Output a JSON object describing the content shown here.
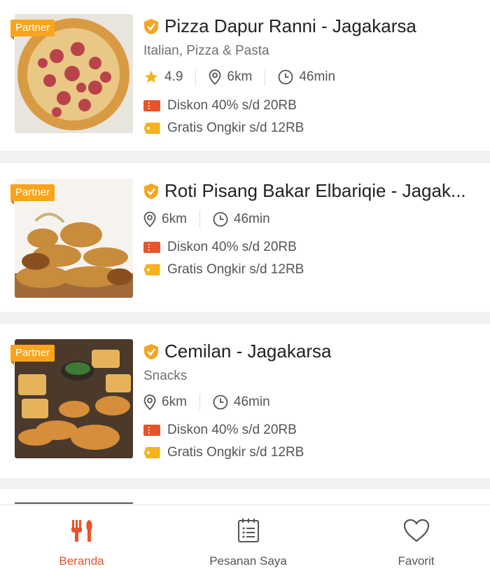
{
  "restaurants": [
    {
      "badge": "Partner",
      "name": "Pizza Dapur Ranni - Jagakarsa",
      "category": "Italian, Pizza & Pasta",
      "rating": "4.9",
      "distance": "6km",
      "time": "46min",
      "promo_discount": "Diskon 40% s/d 20RB",
      "promo_delivery": "Gratis Ongkir s/d 12RB"
    },
    {
      "badge": "Partner",
      "name": "Roti Pisang Bakar Elbariqie - Jagak...",
      "distance": "6km",
      "time": "46min",
      "promo_discount": "Diskon 40% s/d 20RB",
      "promo_delivery": "Gratis Ongkir s/d 12RB"
    },
    {
      "badge": "Partner",
      "name": "Cemilan - Jagakarsa",
      "category": "Snacks",
      "distance": "6km",
      "time": "46min",
      "promo_discount": "Diskon 40% s/d 20RB",
      "promo_delivery": "Gratis Ongkir s/d 12RB"
    }
  ],
  "tabs": [
    {
      "label": "Beranda",
      "icon": "fork-knife-icon",
      "active": true
    },
    {
      "label": "Pesanan Saya",
      "icon": "order-list-icon",
      "active": false
    },
    {
      "label": "Favorit",
      "icon": "heart-icon",
      "active": false
    }
  ],
  "colors": {
    "accent": "#e8542a",
    "badge": "#f9a41b",
    "star": "#f5b21a",
    "discount": "#e8542a",
    "delivery": "#f5b21a"
  }
}
